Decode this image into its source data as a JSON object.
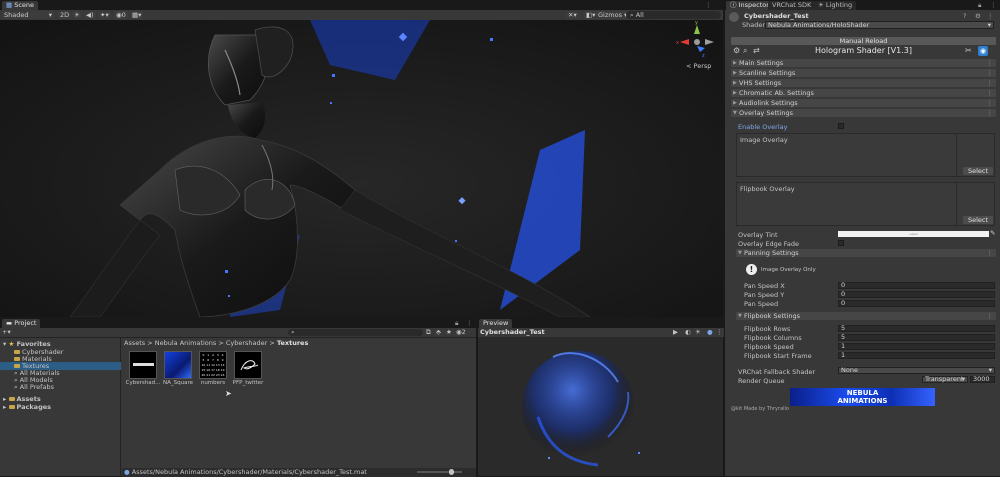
{
  "scene": {
    "tab": "Scene",
    "toolbar": {
      "shading": "Shaded",
      "mode_2d": "2D",
      "gizmos": "Gizmos",
      "search_prefix": "All"
    },
    "persp_label": "< Persp",
    "gizmo_axes": {
      "x": "x",
      "y": "y",
      "z": "z"
    }
  },
  "project": {
    "tab": "Project",
    "counter": "2",
    "favorites": {
      "label": "Favorites",
      "items": [
        "Cybershader",
        "Materials",
        "Textures",
        "All Materials",
        "All Models",
        "All Prefabs"
      ]
    },
    "roots": [
      "Assets",
      "Packages"
    ],
    "breadcrumb": [
      "Assets",
      "Nebula Animations",
      "Cybershader",
      "Textures"
    ],
    "assets": [
      {
        "name": "Cybershad..."
      },
      {
        "name": "NA_Square"
      },
      {
        "name": "numbers"
      },
      {
        "name": "PFP_twitter"
      }
    ],
    "numbers_grid": [
      "0",
      "1",
      "2",
      "3",
      "4",
      "5",
      "6",
      "7",
      "8",
      "9",
      "10",
      "11",
      "12",
      "13",
      "14",
      "15",
      "16",
      "17",
      "18",
      "19",
      "20",
      "21",
      "22",
      "23",
      "24"
    ],
    "status_path": "Assets/Nebula Animations/Cybershader/Materials/Cybershader_Test.mat"
  },
  "preview": {
    "tab": "Preview",
    "title": "Cybershader_Test"
  },
  "inspector": {
    "tabs": [
      "Inspector",
      "VRChat SDK",
      "Lighting"
    ],
    "material_name": "Cybershader_Test",
    "shader_label": "Shader",
    "shader_value": "Nebula Animations/HoloShader",
    "manual_reload": "Manual Reload",
    "header_title": "Hologram Shader [V1.3]",
    "sections": [
      "Main Settings",
      "Scanline Settings",
      "VHS Settings",
      "Chromatic Ab. Settings",
      "Audiolink Settings",
      "Overlay Settings"
    ],
    "enable_overlay": "Enable Overlay",
    "image_overlay": "Image Overlay",
    "flipbook_overlay": "Flipbook Overlay",
    "select": "Select",
    "overlay_tint": "Overlay Tint",
    "tint_value": "Label",
    "overlay_edge_fade": "Overlay Edge Fade",
    "panning": {
      "header": "Panning Settings",
      "note": "Image Overlay Only",
      "fields": [
        {
          "label": "Pan Speed X",
          "value": "0"
        },
        {
          "label": "Pan Speed Y",
          "value": "0"
        },
        {
          "label": "Pan Speed",
          "value": "0"
        }
      ]
    },
    "flipbook": {
      "header": "Flipbook Settings",
      "fields": [
        {
          "label": "Flipbook Rows",
          "value": "5"
        },
        {
          "label": "Flipbook Columns",
          "value": "5"
        },
        {
          "label": "Flipbook Speed",
          "value": "1"
        },
        {
          "label": "Flipbook Start Frame",
          "value": "1"
        }
      ]
    },
    "fallback_label": "VRChat Fallback Shader",
    "fallback_value": "None",
    "render_queue_label": "Render Queue",
    "render_queue_mode": "Transparent",
    "render_queue_value": "3000",
    "banner_line1": "NEBULA",
    "banner_line2": "ANIMATIONS",
    "credit": "@kit Made by Thryrallo"
  },
  "colors": {
    "accent_blue": "#1f4ed8",
    "panel": "#383838",
    "section": "#464646"
  }
}
